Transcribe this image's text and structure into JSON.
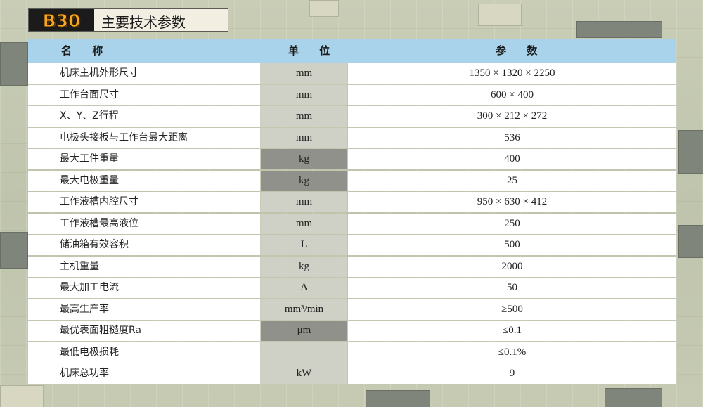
{
  "header": {
    "badge": "B30",
    "title": "主要技术参数"
  },
  "table": {
    "columns": [
      "名 称",
      "单 位",
      "参 数"
    ],
    "rows": [
      {
        "name": "机床主机外形尺寸",
        "unit": "mm",
        "value": "1350 × 1320 × 2250"
      },
      {
        "name": "工作台面尺寸",
        "unit": "mm",
        "value": "600 × 400"
      },
      {
        "name": "X、Y、Z行程",
        "unit": "mm",
        "value": "300 × 212 × 272"
      },
      {
        "name": "电极头接板与工作台最大距离",
        "unit": "mm",
        "value": "536"
      },
      {
        "name": "最大工件重量",
        "unit": "kg",
        "value": "400"
      },
      {
        "name": "最大电极重量",
        "unit": "kg",
        "value": "25"
      },
      {
        "name": "工作液槽内腔尺寸",
        "unit": "mm",
        "value": "950 × 630 × 412"
      },
      {
        "name": "工作液槽最高液位",
        "unit": "mm",
        "value": "250"
      },
      {
        "name": "储油箱有效容积",
        "unit": "L",
        "value": "500"
      },
      {
        "name": "主机重量",
        "unit": "kg",
        "value": "2000"
      },
      {
        "name": "最大加工电流",
        "unit": "A",
        "value": "50"
      },
      {
        "name": "最高生产率",
        "unit": "mm³/min",
        "value": "≥500"
      },
      {
        "name": "最优表面粗糙度Ra",
        "unit": "μm",
        "value": "≤0.1"
      },
      {
        "name": "最低电极损耗",
        "unit": "",
        "value": "≤0.1%"
      },
      {
        "name": "机床总功率",
        "unit": "kW",
        "value": "9"
      }
    ]
  }
}
